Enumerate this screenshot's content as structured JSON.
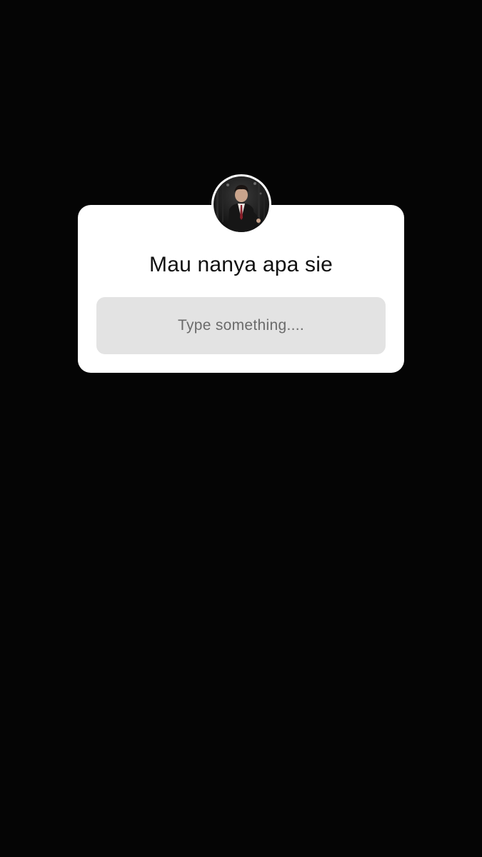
{
  "question_sticker": {
    "avatar": {
      "icon": "profile-photo"
    },
    "question": "Mau nanya apa sie",
    "answer_placeholder": "Type something...."
  },
  "colors": {
    "background": "#050505",
    "card": "#ffffff",
    "input": "#e3e3e3",
    "placeholder": "#6b6b6b"
  }
}
